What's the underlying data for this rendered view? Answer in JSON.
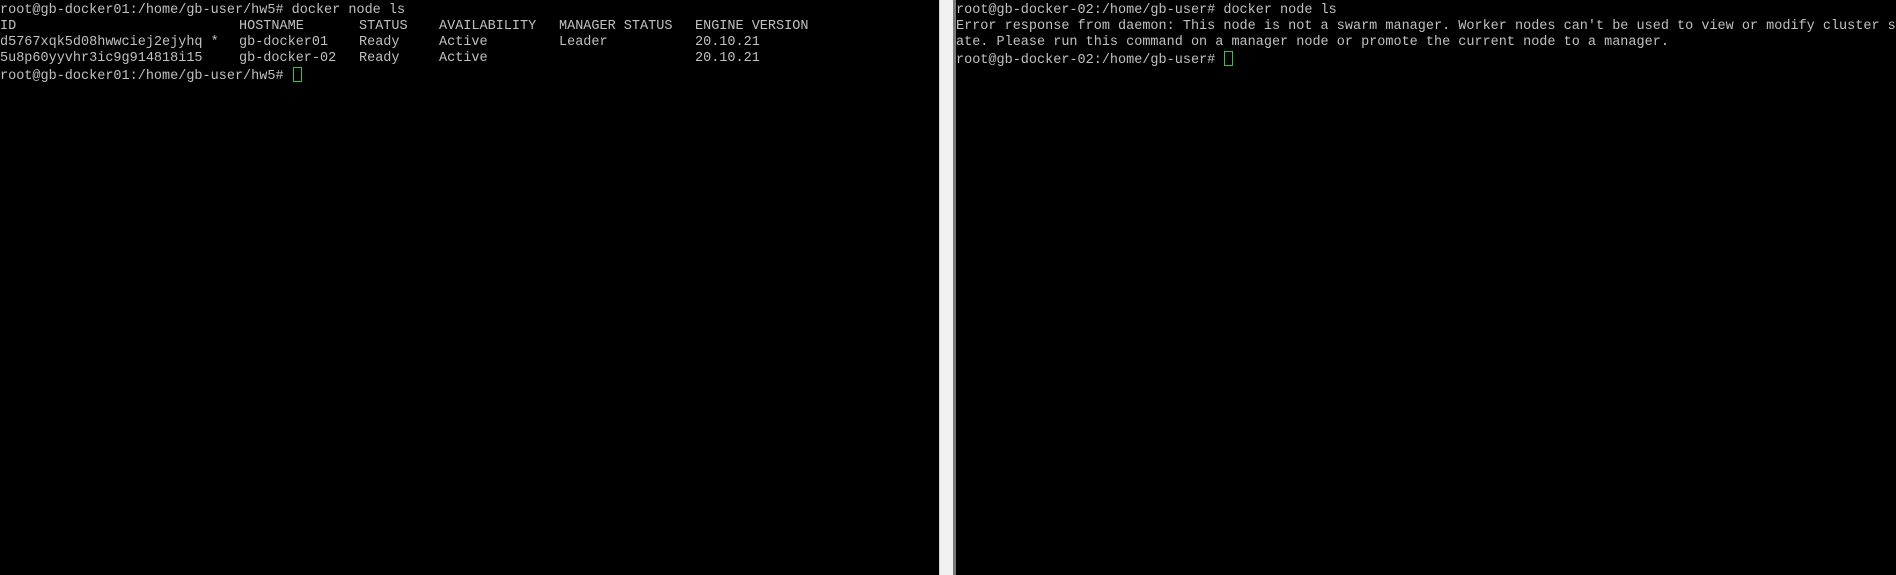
{
  "left_terminal": {
    "prompt": "root@gb-docker01:/home/gb-user/hw5# ",
    "command": "docker node ls",
    "headers": [
      "ID",
      "HOSTNAME",
      "STATUS",
      "AVAILABILITY",
      "MANAGER STATUS",
      "ENGINE VERSION"
    ],
    "rows": [
      [
        "d5767xqk5d08hwwciej2ejyhq *",
        "gb-docker01",
        "Ready",
        "Active",
        "Leader",
        "20.10.21"
      ],
      [
        "5u8p60yyvhr3ic9g914818i15",
        "gb-docker-02",
        "Ready",
        "Active",
        "",
        "20.10.21"
      ]
    ],
    "final_prompt": "root@gb-docker01:/home/gb-user/hw5# "
  },
  "right_terminal": {
    "prompt": "root@gb-docker-02:/home/gb-user# ",
    "command": "docker node ls",
    "error_line_1": "Error response from daemon: This node is not a swarm manager. Worker nodes can't be used to view or modify cluster st",
    "error_line_2": "ate. Please run this command on a manager node or promote the current node to a manager.",
    "final_prompt": "root@gb-docker-02:/home/gb-user# "
  },
  "colors": {
    "background": "#000000",
    "text": "#c0c0c0",
    "cursor": "#3fbf3f"
  }
}
